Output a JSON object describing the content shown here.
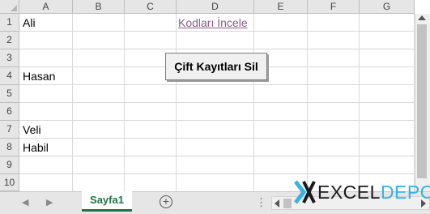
{
  "columns": [
    "A",
    "B",
    "C",
    "D",
    "E",
    "F",
    "G"
  ],
  "rows": [
    "1",
    "2",
    "3",
    "4",
    "5",
    "6",
    "7",
    "8",
    "9",
    "10"
  ],
  "cells": {
    "a1": "Ali",
    "a4": "Hasan",
    "a7": "Veli",
    "a8": "Habil",
    "d1_link": "Kodları İncele"
  },
  "button": {
    "label": "Çift Kayıtları Sil"
  },
  "sheet_tab": "Sayfa1",
  "watermark": {
    "part1": "EXCEL",
    "part2": "DEPO"
  },
  "colors": {
    "excel_green": "#217346",
    "link": "#8e5b8c",
    "watermark_blue": "#33b3e8"
  }
}
